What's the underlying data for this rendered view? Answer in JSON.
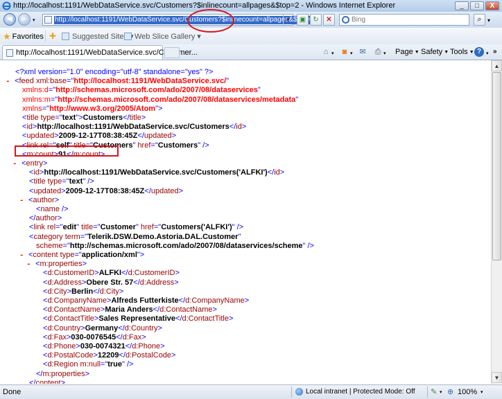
{
  "window": {
    "title": "http://localhost:1191/WebDataService.svc/Customers?$inlinecount=allpages&$top=2 - Windows Internet Explorer",
    "min": "_",
    "max": "□",
    "close": "X"
  },
  "address": {
    "url": "http://localhost:1191/WebDataService.svc/Customers?$inlinecount=allpages&$top=2",
    "search_placeholder": "Bing"
  },
  "favorites": {
    "label": "Favorites",
    "items": [
      {
        "label": "Suggested Sites ▾"
      },
      {
        "label": "Web Slice Gallery ▾"
      }
    ]
  },
  "tab": {
    "label": "http://localhost:1191/WebDataService.svc/Customer..."
  },
  "commands": {
    "page": "Page",
    "safety": "Safety",
    "tools": "Tools"
  },
  "xml_lines": [
    {
      "indent": 0,
      "col": "",
      "html": "<span class=\"pi\">&lt;?xml version=\"1.0\" encoding=\"utf-8\" standalone=\"yes\" ?&gt;</span>"
    },
    {
      "indent": 0,
      "col": "-",
      "html": "<span class=\"m\">&lt;</span><span class=\"t\">feed</span> <span class=\"a\">xml:base</span><span class=\"m\">=\"</span><span class=\"nsv\">http://localhost:1191/WebDataService.svc/</span><span class=\"m\">\"</span>"
    },
    {
      "indent": 1,
      "col": "",
      "html": "<span class=\"ns\">xmlns:d</span><span class=\"m\">=\"</span><span class=\"nsv\">http://schemas.microsoft.com/ado/2007/08/dataservices</span><span class=\"m\">\"</span>"
    },
    {
      "indent": 1,
      "col": "",
      "html": "<span class=\"ns\">xmlns:m</span><span class=\"m\">=\"</span><span class=\"nsv\">http://schemas.microsoft.com/ado/2007/08/dataservices/metadata</span><span class=\"m\">\"</span>"
    },
    {
      "indent": 1,
      "col": "",
      "html": "<span class=\"ns\">xmlns</span><span class=\"m\">=\"</span><span class=\"nsv\">http://www.w3.org/2005/Atom</span><span class=\"m\">\"&gt;</span>"
    },
    {
      "indent": 1,
      "col": "",
      "html": "<span class=\"m\">&lt;</span><span class=\"t\">title</span> <span class=\"a\">type</span><span class=\"m\">=\"</span><span class=\"v\">text</span><span class=\"m\">\"&gt;</span><span class=\"tx\">Customers</span><span class=\"m\">&lt;/</span><span class=\"t\">title</span><span class=\"m\">&gt;</span>"
    },
    {
      "indent": 1,
      "col": "",
      "html": "<span class=\"m\">&lt;</span><span class=\"t\">id</span><span class=\"m\">&gt;</span><span class=\"tx\">http://localhost:1191/WebDataService.svc/Customers</span><span class=\"m\">&lt;/</span><span class=\"t\">id</span><span class=\"m\">&gt;</span>"
    },
    {
      "indent": 1,
      "col": "",
      "html": "<span class=\"m\">&lt;</span><span class=\"t\">updated</span><span class=\"m\">&gt;</span><span class=\"tx\">2009-12-17T08:38:45Z</span><span class=\"m\">&lt;/</span><span class=\"t\">updated</span><span class=\"m\">&gt;</span>"
    },
    {
      "indent": 1,
      "col": "",
      "html": "<span class=\"m\">&lt;</span><span class=\"t\">link</span> <span class=\"a\">rel</span><span class=\"m\">=\"</span><span class=\"v\">self</span><span class=\"m\">\"</span> <span class=\"a\">title</span><span class=\"m\">=\"</span><span class=\"v\">Customers</span><span class=\"m\">\"</span> <span class=\"a\">href</span><span class=\"m\">=\"</span><span class=\"v\">Customers</span><span class=\"m\">\" /&gt;</span>"
    },
    {
      "indent": 1,
      "col": "",
      "html": "<span class=\"m\">&lt;</span><span class=\"t\">m:count</span><span class=\"m\">&gt;</span><span class=\"tx\">91</span><span class=\"m\">&lt;/</span><span class=\"t\">m:count</span><span class=\"m\">&gt;</span>"
    },
    {
      "indent": 1,
      "col": "-",
      "html": "<span class=\"m\">&lt;</span><span class=\"t\">entry</span><span class=\"m\">&gt;</span>"
    },
    {
      "indent": 2,
      "col": "",
      "html": "<span class=\"m\">&lt;</span><span class=\"t\">id</span><span class=\"m\">&gt;</span><span class=\"tx\">http://localhost:1191/WebDataService.svc/Customers('ALFKI')</span><span class=\"m\">&lt;/</span><span class=\"t\">id</span><span class=\"m\">&gt;</span>"
    },
    {
      "indent": 2,
      "col": "",
      "html": "<span class=\"m\">&lt;</span><span class=\"t\">title</span> <span class=\"a\">type</span><span class=\"m\">=\"</span><span class=\"v\">text</span><span class=\"m\">\" /&gt;</span>"
    },
    {
      "indent": 2,
      "col": "",
      "html": "<span class=\"m\">&lt;</span><span class=\"t\">updated</span><span class=\"m\">&gt;</span><span class=\"tx\">2009-12-17T08:38:45Z</span><span class=\"m\">&lt;/</span><span class=\"t\">updated</span><span class=\"m\">&gt;</span>"
    },
    {
      "indent": 2,
      "col": "-",
      "html": "<span class=\"m\">&lt;</span><span class=\"t\">author</span><span class=\"m\">&gt;</span>"
    },
    {
      "indent": 3,
      "col": "",
      "html": "<span class=\"m\">&lt;</span><span class=\"t\">name</span> <span class=\"m\">/&gt;</span>"
    },
    {
      "indent": 2,
      "col": "",
      "html": "<span class=\"m\">&lt;/</span><span class=\"t\">author</span><span class=\"m\">&gt;</span>"
    },
    {
      "indent": 2,
      "col": "",
      "html": "<span class=\"m\">&lt;</span><span class=\"t\">link</span> <span class=\"a\">rel</span><span class=\"m\">=\"</span><span class=\"v\">edit</span><span class=\"m\">\"</span> <span class=\"a\">title</span><span class=\"m\">=\"</span><span class=\"v\">Customer</span><span class=\"m\">\"</span> <span class=\"a\">href</span><span class=\"m\">=\"</span><span class=\"v\">Customers('ALFKI')</span><span class=\"m\">\" /&gt;</span>"
    },
    {
      "indent": 2,
      "col": "",
      "html": "<span class=\"m\">&lt;</span><span class=\"t\">category</span> <span class=\"a\">term</span><span class=\"m\">=\"</span><span class=\"v\">Telerik.DSW.Demo.Astoria.DAL.Customer</span><span class=\"m\">\"</span>"
    },
    {
      "indent": 3,
      "col": "",
      "html": "<span class=\"a\">scheme</span><span class=\"m\">=\"</span><span class=\"v\">http://schemas.microsoft.com/ado/2007/08/dataservices/scheme</span><span class=\"m\">\" /&gt;</span>"
    },
    {
      "indent": 2,
      "col": "-",
      "html": "<span class=\"m\">&lt;</span><span class=\"t\">content</span> <span class=\"a\">type</span><span class=\"m\">=\"</span><span class=\"v\">application/xml</span><span class=\"m\">\"&gt;</span>"
    },
    {
      "indent": 3,
      "col": "-",
      "html": "<span class=\"m\">&lt;</span><span class=\"t\">m:properties</span><span class=\"m\">&gt;</span>"
    },
    {
      "indent": 4,
      "col": "",
      "html": "<span class=\"m\">&lt;</span><span class=\"t\">d:CustomerID</span><span class=\"m\">&gt;</span><span class=\"tx\">ALFKI</span><span class=\"m\">&lt;/</span><span class=\"t\">d:CustomerID</span><span class=\"m\">&gt;</span>"
    },
    {
      "indent": 4,
      "col": "",
      "html": "<span class=\"m\">&lt;</span><span class=\"t\">d:Address</span><span class=\"m\">&gt;</span><span class=\"tx\">Obere Str. 57</span><span class=\"m\">&lt;/</span><span class=\"t\">d:Address</span><span class=\"m\">&gt;</span>"
    },
    {
      "indent": 4,
      "col": "",
      "html": "<span class=\"m\">&lt;</span><span class=\"t\">d:City</span><span class=\"m\">&gt;</span><span class=\"tx\">Berlin</span><span class=\"m\">&lt;/</span><span class=\"t\">d:City</span><span class=\"m\">&gt;</span>"
    },
    {
      "indent": 4,
      "col": "",
      "html": "<span class=\"m\">&lt;</span><span class=\"t\">d:CompanyName</span><span class=\"m\">&gt;</span><span class=\"tx\">Alfreds Futterkiste</span><span class=\"m\">&lt;/</span><span class=\"t\">d:CompanyName</span><span class=\"m\">&gt;</span>"
    },
    {
      "indent": 4,
      "col": "",
      "html": "<span class=\"m\">&lt;</span><span class=\"t\">d:ContactName</span><span class=\"m\">&gt;</span><span class=\"tx\">Maria Anders</span><span class=\"m\">&lt;/</span><span class=\"t\">d:ContactName</span><span class=\"m\">&gt;</span>"
    },
    {
      "indent": 4,
      "col": "",
      "html": "<span class=\"m\">&lt;</span><span class=\"t\">d:ContactTitle</span><span class=\"m\">&gt;</span><span class=\"tx\">Sales Representative</span><span class=\"m\">&lt;/</span><span class=\"t\">d:ContactTitle</span><span class=\"m\">&gt;</span>"
    },
    {
      "indent": 4,
      "col": "",
      "html": "<span class=\"m\">&lt;</span><span class=\"t\">d:Country</span><span class=\"m\">&gt;</span><span class=\"tx\">Germany</span><span class=\"m\">&lt;/</span><span class=\"t\">d:Country</span><span class=\"m\">&gt;</span>"
    },
    {
      "indent": 4,
      "col": "",
      "html": "<span class=\"m\">&lt;</span><span class=\"t\">d:Fax</span><span class=\"m\">&gt;</span><span class=\"tx\">030-0076545</span><span class=\"m\">&lt;/</span><span class=\"t\">d:Fax</span><span class=\"m\">&gt;</span>"
    },
    {
      "indent": 4,
      "col": "",
      "html": "<span class=\"m\">&lt;</span><span class=\"t\">d:Phone</span><span class=\"m\">&gt;</span><span class=\"tx\">030-0074321</span><span class=\"m\">&lt;/</span><span class=\"t\">d:Phone</span><span class=\"m\">&gt;</span>"
    },
    {
      "indent": 4,
      "col": "",
      "html": "<span class=\"m\">&lt;</span><span class=\"t\">d:PostalCode</span><span class=\"m\">&gt;</span><span class=\"tx\">12209</span><span class=\"m\">&lt;/</span><span class=\"t\">d:PostalCode</span><span class=\"m\">&gt;</span>"
    },
    {
      "indent": 4,
      "col": "",
      "html": "<span class=\"m\">&lt;</span><span class=\"t\">d:Region</span> <span class=\"a\">m:null</span><span class=\"m\">=\"</span><span class=\"v\">true</span><span class=\"m\">\" /&gt;</span>"
    },
    {
      "indent": 3,
      "col": "",
      "html": "<span class=\"m\">&lt;/</span><span class=\"t\">m:properties</span><span class=\"m\">&gt;</span>"
    },
    {
      "indent": 2,
      "col": "",
      "html": "<span class=\"m\">&lt;/</span><span class=\"t\">content</span><span class=\"m\">&gt;</span>"
    }
  ],
  "status": {
    "text": "Done",
    "zone": "Local intranet | Protected Mode: Off",
    "zoom": "100%"
  },
  "colors": {
    "markup": "#0000ff",
    "tag": "#990000",
    "namespace": "#ff0000",
    "highlight": "#d8141c"
  }
}
